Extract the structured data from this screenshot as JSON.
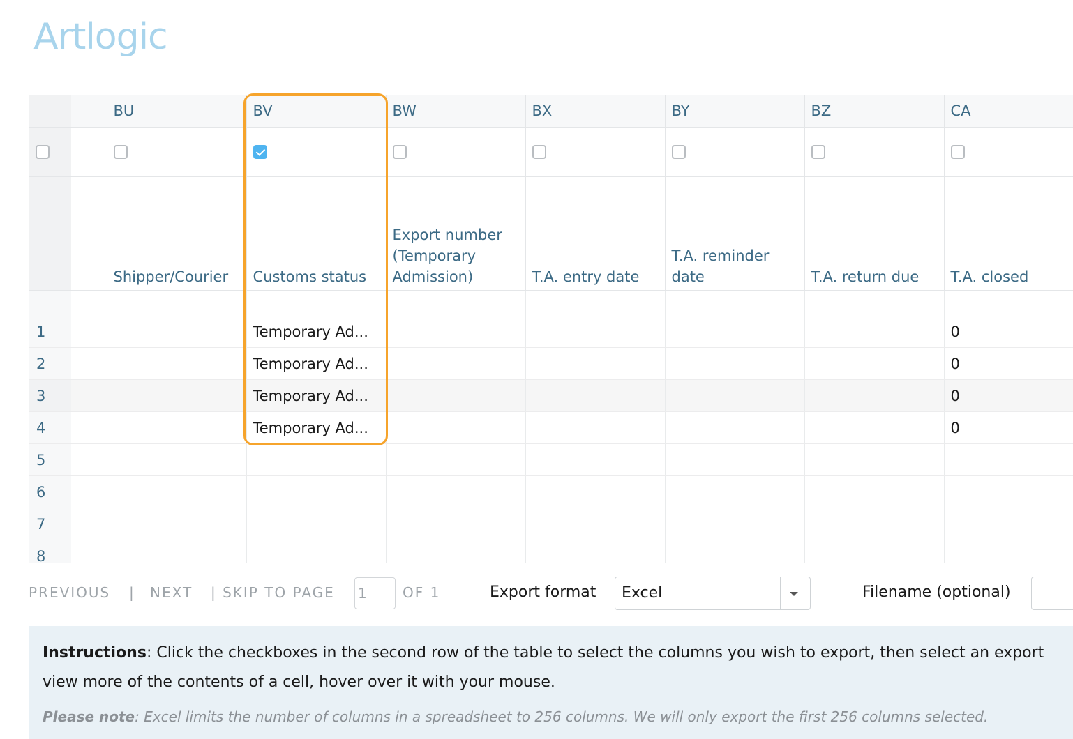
{
  "brand": {
    "logo_text": "Artlogic",
    "color": "#a8d4ec"
  },
  "colors": {
    "accent_highlight": "#f6a42c",
    "checkbox_checked": "#4fb4f0",
    "header_text": "#3c6a85",
    "instructions_bg": "#e9f1f6"
  },
  "columns": [
    {
      "letter": "BU",
      "header": "Shipper/Courier",
      "checked": false
    },
    {
      "letter": "BV",
      "header": "Customs status",
      "checked": true
    },
    {
      "letter": "BW",
      "header": "Export number (Temporary Admission)",
      "checked": false
    },
    {
      "letter": "BX",
      "header": "T.A. entry date",
      "checked": false
    },
    {
      "letter": "BY",
      "header": "T.A. reminder date",
      "checked": false
    },
    {
      "letter": "BZ",
      "header": "T.A. return due",
      "checked": false
    },
    {
      "letter": "CA",
      "header": "T.A. closed",
      "checked": false
    }
  ],
  "select_all_checked": false,
  "rows": [
    {
      "num": "1",
      "cells": [
        "",
        "Temporary Ad...",
        "",
        "",
        "",
        "",
        "0"
      ]
    },
    {
      "num": "2",
      "cells": [
        "",
        "Temporary Ad...",
        "",
        "",
        "",
        "",
        "0"
      ]
    },
    {
      "num": "3",
      "cells": [
        "",
        "Temporary Ad...",
        "",
        "",
        "",
        "",
        "0"
      ]
    },
    {
      "num": "4",
      "cells": [
        "",
        "Temporary Ad...",
        "",
        "",
        "",
        "",
        "0"
      ]
    },
    {
      "num": "5",
      "cells": [
        "",
        "",
        "",
        "",
        "",
        "",
        ""
      ]
    },
    {
      "num": "6",
      "cells": [
        "",
        "",
        "",
        "",
        "",
        "",
        ""
      ]
    },
    {
      "num": "7",
      "cells": [
        "",
        "",
        "",
        "",
        "",
        "",
        ""
      ]
    },
    {
      "num": "8",
      "cells": [
        "",
        "",
        "",
        "",
        "",
        "",
        ""
      ]
    }
  ],
  "pagination": {
    "previous": "PREVIOUS",
    "sep": "|",
    "next": "NEXT",
    "skip": "| SKIP TO PAGE",
    "page_value": "1",
    "of": "OF 1"
  },
  "export": {
    "format_label": "Export format",
    "format_value": "Excel",
    "filename_label": "Filename (optional)",
    "filename_value": ""
  },
  "instructions": {
    "label": "Instructions",
    "line1": ": Click the checkboxes in the second row of the table to select the columns you wish to export, then select an export",
    "line2": "view more of the contents of a cell, hover over it with your mouse.",
    "note_label": "Please note",
    "note_text": ": Excel limits the number of columns in a spreadsheet to 256 columns. We will only export the first 256 columns selected."
  }
}
